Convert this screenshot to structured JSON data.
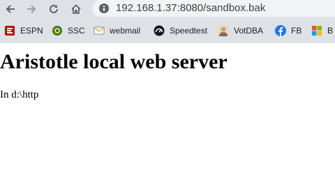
{
  "toolbar": {
    "back_icon": "back-arrow-icon",
    "forward_icon": "forward-arrow-icon",
    "reload_icon": "reload-icon",
    "home_icon": "home-icon",
    "site_info_icon": "site-info-icon",
    "url": "192.168.1.37:8080/sandbox.bak"
  },
  "bookmarks": [
    {
      "label": "ESPN",
      "icon": "espn-icon",
      "color": "#d00000"
    },
    {
      "label": "SSC",
      "icon": "ssc-icon",
      "color": "#2e7d32"
    },
    {
      "label": "webmail",
      "icon": "mail-icon",
      "color": "#e8b34a"
    },
    {
      "label": "Speedtest",
      "icon": "speedtest-icon",
      "color": "#141526"
    },
    {
      "label": "VotDBA",
      "icon": "avatar-icon",
      "color": "#c8a27a"
    },
    {
      "label": "FB",
      "icon": "facebook-icon",
      "color": "#1877f2"
    },
    {
      "label": "B",
      "icon": "microsoft-icon",
      "color": "#f25022"
    }
  ],
  "page": {
    "heading": "Aristotle local web server",
    "text": "In d:\\http"
  }
}
